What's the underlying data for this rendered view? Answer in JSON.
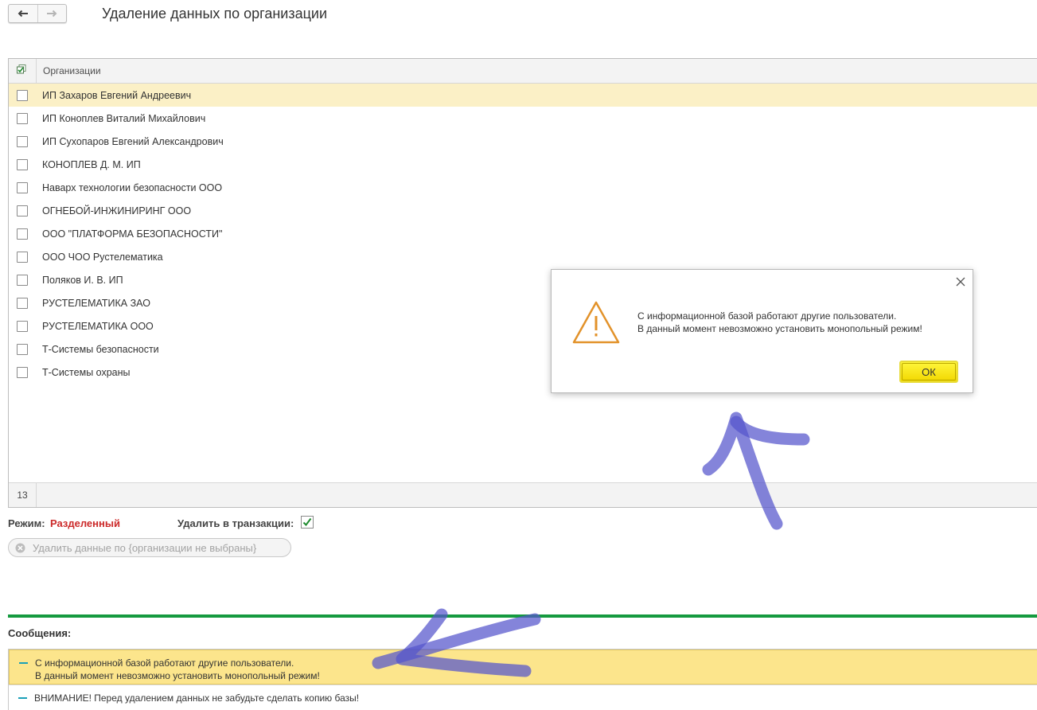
{
  "page": {
    "title": "Удаление данных по организации"
  },
  "nav": {
    "back_icon": "arrow-left-icon",
    "forward_icon": "arrow-right-icon"
  },
  "table": {
    "column_header": "Организации",
    "rows": [
      {
        "label": "ИП Захаров Евгений Андреевич",
        "checked": false,
        "selected": true
      },
      {
        "label": "ИП Коноплев Виталий Михайлович",
        "checked": false
      },
      {
        "label": "ИП Сухопаров Евгений Александрович",
        "checked": false
      },
      {
        "label": "КОНОПЛЕВ Д. М. ИП",
        "checked": false
      },
      {
        "label": "Наварх технологии безопасности ООО",
        "checked": false
      },
      {
        "label": "ОГНЕБОЙ-ИНЖИНИРИНГ ООО",
        "checked": false
      },
      {
        "label": "ООО \"ПЛАТФОРМА  БЕЗОПАСНОСТИ\"",
        "checked": false
      },
      {
        "label": "ООО ЧОО Рустелематика",
        "checked": false
      },
      {
        "label": "Поляков И. В. ИП",
        "checked": false
      },
      {
        "label": "РУСТЕЛЕМАТИКА ЗАО",
        "checked": false
      },
      {
        "label": "РУСТЕЛЕМАТИКА ООО",
        "checked": false
      },
      {
        "label": "Т-Системы безопасности",
        "checked": false
      },
      {
        "label": "Т-Системы охраны",
        "checked": false
      }
    ],
    "footer_count": "13"
  },
  "mode": {
    "label": "Режим:",
    "value": "Разделенный",
    "value_color": "#cc2a2a",
    "transaction_label": "Удалить в транзакции:",
    "transaction_checked": true
  },
  "delete_button": {
    "label": "Удалить данные по {организации не выбраны}"
  },
  "messages": {
    "title": "Сообщения:",
    "items": [
      {
        "line1": "С информационной базой работают другие пользователи.",
        "line2": "В данный момент невозможно установить монопольный режим!"
      },
      {
        "line1": "ВНИМАНИЕ! Перед удалением данных не забудьте сделать копию базы!"
      }
    ]
  },
  "dialog": {
    "line1": "С информационной базой работают другие пользователи.",
    "line2": "В данный момент невозможно установить монопольный режим!",
    "ok_label": "ОК",
    "icon": "warning-triangle-icon"
  },
  "colors": {
    "accent_green": "#159a3f",
    "selection": "#fbf0c6",
    "warning_orange": "#e2922a",
    "ok_yellow": "#fff63c"
  }
}
